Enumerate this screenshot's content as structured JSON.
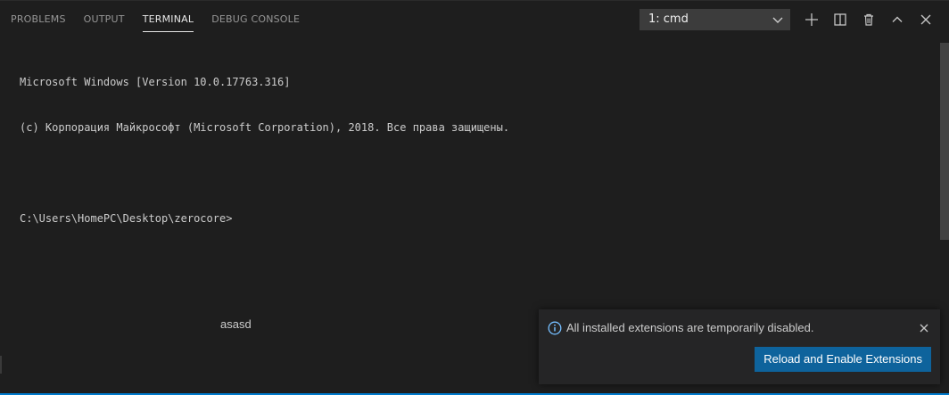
{
  "panel": {
    "tabs": [
      {
        "label": "PROBLEMS",
        "active": false
      },
      {
        "label": "OUTPUT",
        "active": false
      },
      {
        "label": "TERMINAL",
        "active": true
      },
      {
        "label": "DEBUG CONSOLE",
        "active": false
      }
    ],
    "terminal_select": {
      "value": "1: cmd"
    },
    "actions": [
      {
        "icon": "plus-icon",
        "title": "New Terminal"
      },
      {
        "icon": "split-icon",
        "title": "Split Terminal"
      },
      {
        "icon": "trash-icon",
        "title": "Kill Terminal"
      },
      {
        "icon": "chevron-up-icon",
        "title": "Maximize Panel"
      },
      {
        "icon": "close-icon",
        "title": "Close Panel"
      }
    ]
  },
  "terminal": {
    "lines": [
      "Microsoft Windows [Version 10.0.17763.316]",
      "(c) Корпорация Майкрософт (Microsoft Corporation), 2018. Все права защищены.",
      "",
      "C:\\Users\\HomePC\\Desktop\\zerocore>"
    ]
  },
  "floating_text": "asasd",
  "notification": {
    "icon": "info-icon",
    "message": "All installed extensions are temporarily disabled.",
    "button_label": "Reload and Enable Extensions"
  },
  "colors": {
    "background": "#1e1e1e",
    "accent": "#007acc",
    "button": "#0e639c"
  }
}
